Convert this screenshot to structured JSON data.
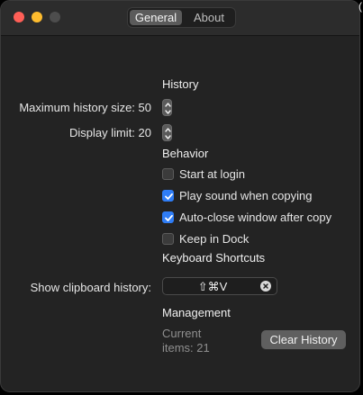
{
  "window": {
    "tabs": {
      "general": "General",
      "about": "About"
    },
    "edge_char": "("
  },
  "history": {
    "heading": "History",
    "max_size_label": "Maximum history size: 50",
    "display_limit_label": "Display limit: 20"
  },
  "behavior": {
    "heading": "Behavior",
    "items": [
      {
        "label": "Start at login",
        "checked": false
      },
      {
        "label": "Play sound when copying",
        "checked": true
      },
      {
        "label": "Auto-close window after copy",
        "checked": true
      },
      {
        "label": "Keep in Dock",
        "checked": false
      }
    ]
  },
  "shortcuts": {
    "heading": "Keyboard Shortcuts",
    "show_history_label": "Show clipboard history:",
    "show_history_value": "⇧⌘V"
  },
  "management": {
    "heading": "Management",
    "current_items_line1": "Current",
    "current_items_line2": "items: 21",
    "clear_button": "Clear History"
  },
  "colors": {
    "accent": "#2f7df6",
    "close": "#ff5f57",
    "minimize": "#febc2e"
  }
}
